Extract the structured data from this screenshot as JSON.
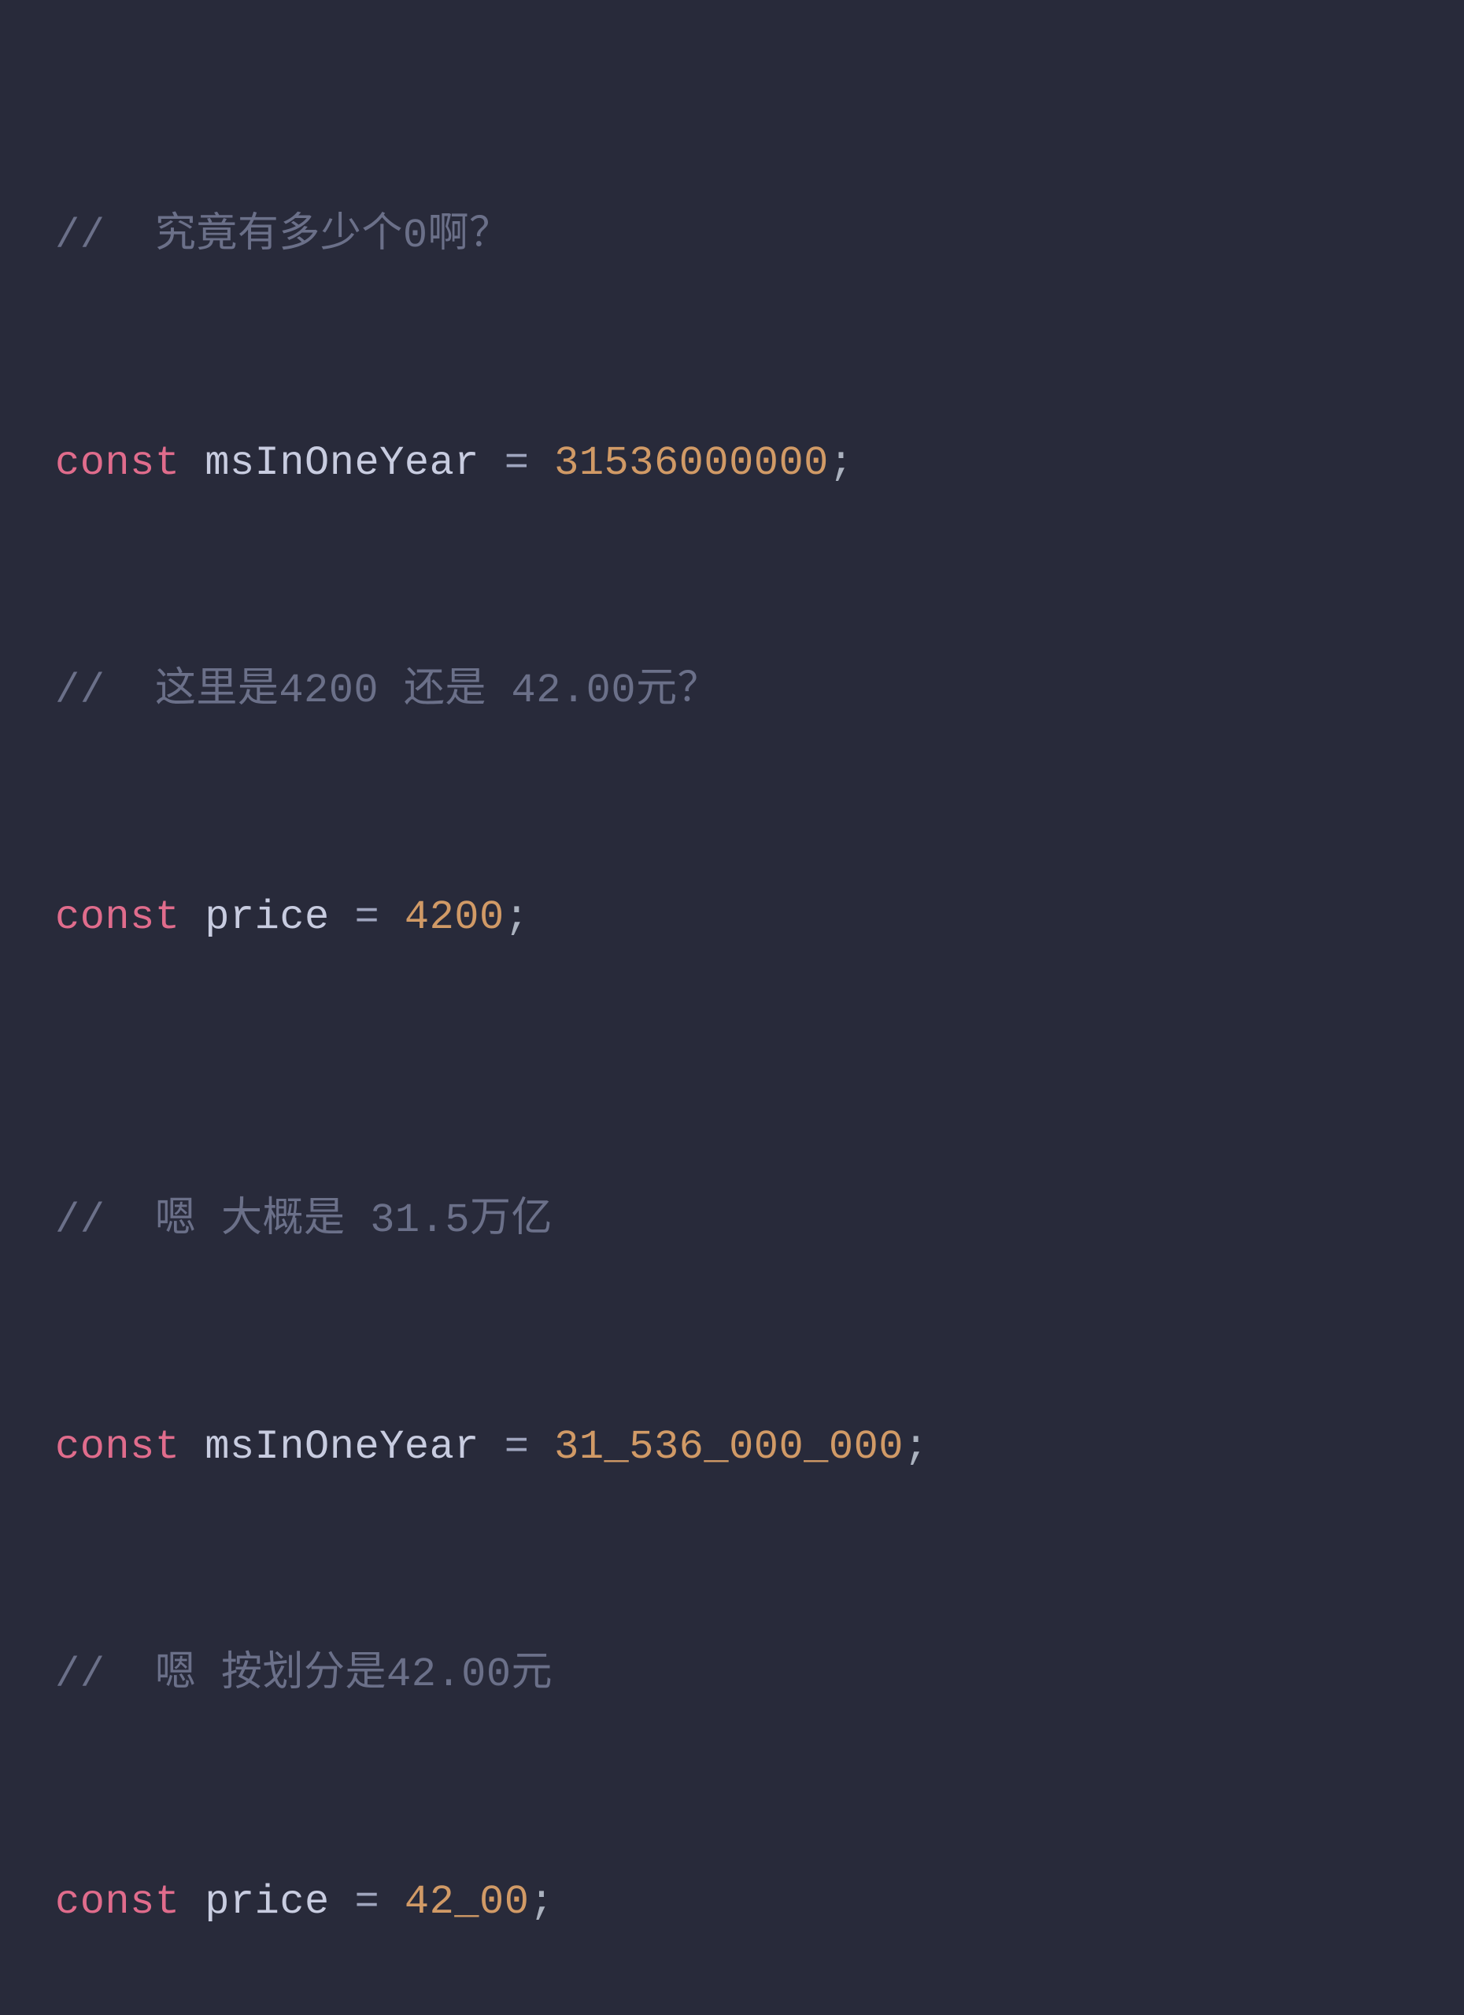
{
  "code": {
    "line1": {
      "comment": "//  究竟有多少个0啊？"
    },
    "line2": {
      "keyword": "const",
      "identifier": " msInOneYear ",
      "operator": "=",
      "number": " 31536000000",
      "punct": ";"
    },
    "line3": {
      "comment": "//  这里是4200 还是 42.00元？"
    },
    "line4": {
      "keyword": "const",
      "identifier": " price ",
      "operator": "=",
      "number": " 4200",
      "punct": ";"
    },
    "line6": {
      "comment": "//  嗯 大概是 31.5万亿"
    },
    "line7": {
      "keyword": "const",
      "identifier": " msInOneYear ",
      "operator": "=",
      "number": " 31_536_000_000",
      "punct": ";"
    },
    "line8": {
      "comment": "//  嗯 按划分是42.00元"
    },
    "line9": {
      "keyword": "const",
      "identifier": " price ",
      "operator": "=",
      "number": " 42_00",
      "punct": ";"
    }
  }
}
